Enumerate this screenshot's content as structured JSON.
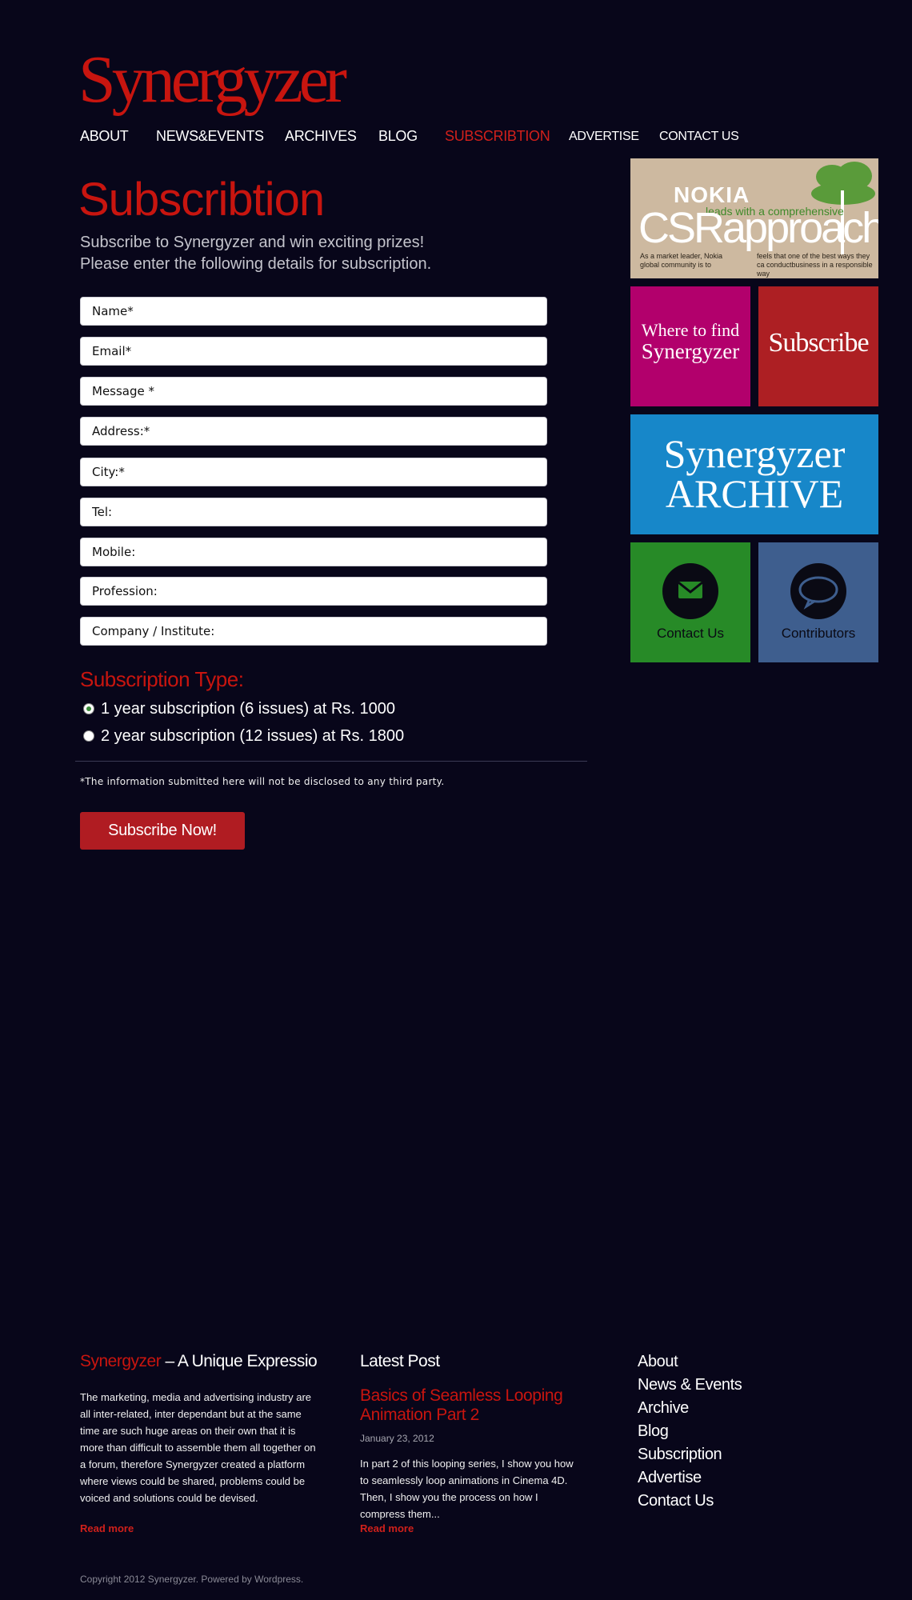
{
  "site": {
    "logo": "Synergyzer"
  },
  "nav": {
    "items": [
      {
        "label": "ABOUT"
      },
      {
        "label": "NEWS&EVENTS"
      },
      {
        "label": "ARCHIVES"
      },
      {
        "label": "BLOG"
      },
      {
        "label": "SUBSCRIBTION",
        "active": true
      },
      {
        "label": "ADVERTISE"
      },
      {
        "label": "CONTACT US"
      }
    ],
    "active_color": "#d0201b"
  },
  "main": {
    "title": "Subscribtion",
    "intro_line1": "Subscribe to Synergyzer and win exciting prizes!",
    "intro_line2": "Please enter the following details for subscription.",
    "fields": {
      "name": {
        "placeholder": "Name*",
        "value": ""
      },
      "email": {
        "placeholder": "Email*",
        "value": ""
      },
      "message": {
        "placeholder": "Message *",
        "value": ""
      },
      "address": {
        "placeholder": "Address:*",
        "value": ""
      },
      "city": {
        "placeholder": "City:*",
        "value": ""
      },
      "tel": {
        "placeholder": "Tel:",
        "value": ""
      },
      "mobile": {
        "placeholder": "Mobile:",
        "value": ""
      },
      "profession": {
        "placeholder": "Profession:",
        "value": ""
      },
      "company": {
        "placeholder": "Company / Institute:",
        "value": ""
      }
    },
    "subscription_type_title": "Subscription Type:",
    "options": [
      {
        "label": "1 year subscription (6 issues) at Rs. 1000",
        "selected": true
      },
      {
        "label": "2 year subscription (12 issues) at Rs. 1800",
        "selected": false
      }
    ],
    "disclaimer": "*The information submitted here will not be disclosed to any third party.",
    "submit_label": "Subscribe Now!"
  },
  "sidebar": {
    "nokia_ad": {
      "brand": "NOKIA",
      "tagline": "leads with a comprehensive",
      "headline": "CSRapproach",
      "text_left": "As a market leader, Nokia global community is to",
      "text_right": "feels that one of the best ways they ca conductbusiness in a responsible way"
    },
    "where_tile": {
      "line1": "Where to find",
      "line2": "Synergyzer",
      "color": "#b2006c"
    },
    "subscribe_tile": {
      "label": "Subscribe",
      "color": "#ad1f23"
    },
    "archive_tile": {
      "line1": "Synergyzer",
      "line2": "ARCHIVE",
      "color": "#1787c9"
    },
    "contact_tile": {
      "label": "Contact Us",
      "icon": "envelope-icon",
      "color": "#278a27"
    },
    "contributors_tile": {
      "label": "Contributors",
      "icon": "speech-bubble-icon",
      "color": "#3e5e8e"
    }
  },
  "footer": {
    "about": {
      "title_brand": "Synergyzer",
      "title_rest": " – A Unique Expressio",
      "text": "The marketing, media and advertising industry are all inter-related, inter dependant but at the same time are such huge areas on their own that it is more than difficult to assemble them all together on a forum, therefore Synergyzer created a platform where views could be shared, problems could be voiced and solutions could be devised.",
      "read_more": "Read more"
    },
    "latest": {
      "title": "Latest Post",
      "post_title": "Basics of Seamless Looping Animation Part 2",
      "date": "January 23, 2012",
      "excerpt": "In part 2 of this looping series, I show you how to seamlessly loop animations in Cinema 4D. Then, I show you the process on how I compress them...",
      "read_more": "Read more"
    },
    "links": [
      {
        "label": "About"
      },
      {
        "label": "News & Events"
      },
      {
        "label": "Archive"
      },
      {
        "label": "Blog"
      },
      {
        "label": "Subscription"
      },
      {
        "label": "Advertise"
      },
      {
        "label": "Contact Us"
      }
    ],
    "copyright": "Copyright 2012 Synergyzer. Powered by Wordpress."
  }
}
